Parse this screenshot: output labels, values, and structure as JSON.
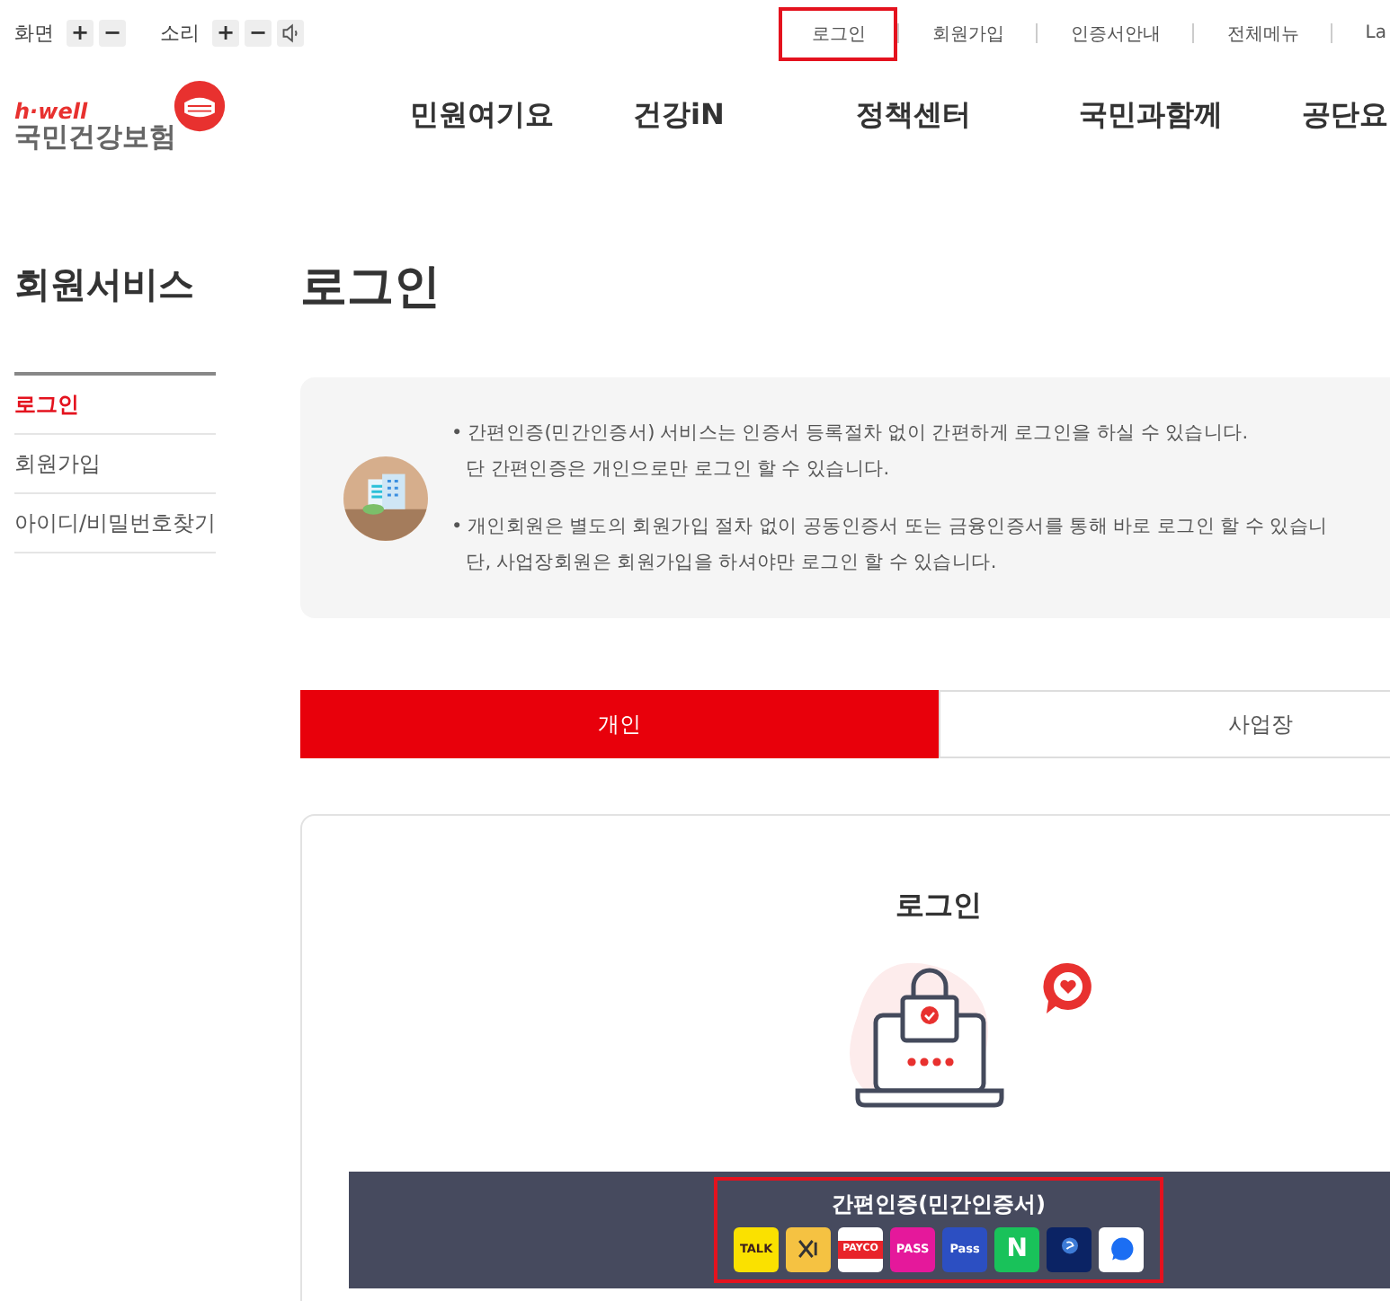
{
  "utility_bar": {
    "screen_label": "화면",
    "sound_label": "소리",
    "zoom_in": "+",
    "zoom_out": "−",
    "volume_up": "+",
    "volume_down": "−"
  },
  "top_links": [
    {
      "label": "로그인",
      "highlighted": true
    },
    {
      "label": "회원가입",
      "highlighted": false
    },
    {
      "label": "인증서안내",
      "highlighted": false
    },
    {
      "label": "전체메뉴",
      "highlighted": false
    },
    {
      "label": "La",
      "highlighted": false
    }
  ],
  "logo": {
    "tagline": "h·well",
    "name": "국민건강보험"
  },
  "nav": [
    "민원여기요",
    "건강iN",
    "정책센터",
    "국민과함께",
    "공단요"
  ],
  "sidebar": {
    "title": "회원서비스",
    "items": [
      {
        "label": "로그인",
        "selected": true
      },
      {
        "label": "회원가입",
        "selected": false
      },
      {
        "label": "아이디/비밀번호찾기",
        "selected": false
      }
    ]
  },
  "page_title": "로그인",
  "notice": [
    [
      "• 간편인증(민간인증서) 서비스는 인증서 등록절차 없이 간편하게 로그인을 하실 수 있습니다.",
      "단 간편인증은 개인으로만 로그인 할 수 있습니다."
    ],
    [
      "• 개인회원은 별도의 회원가입 절차 없이 공동인증서 또는 금융인증서를 통해 바로 로그인 할 수 있습니",
      "단, 사업장회원은 회원가입을 하셔야만 로그인 할 수 있습니다."
    ]
  ],
  "tabs": [
    {
      "label": "개인",
      "selected": true
    },
    {
      "label": "사업장",
      "selected": false
    }
  ],
  "login_card": {
    "title": "로그인",
    "simple_auth": {
      "title": "간편인증(민간인증서)",
      "highlighted": true,
      "providers": [
        {
          "kind": "kakao",
          "label": "TALK"
        },
        {
          "kind": "kb"
        },
        {
          "kind": "payco",
          "label": "PAYCO"
        },
        {
          "kind": "pass",
          "label": "PASS"
        },
        {
          "kind": "samsung",
          "label": "Pass"
        },
        {
          "kind": "naver",
          "label": "N"
        },
        {
          "kind": "shinhan"
        },
        {
          "kind": "toss"
        }
      ]
    }
  }
}
